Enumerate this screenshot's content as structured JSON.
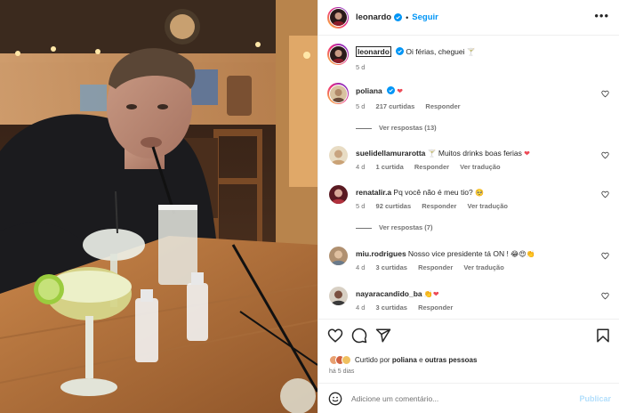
{
  "post": {
    "author": "leonardo",
    "follow_label": "Seguir",
    "caption": "Oi férias, cheguei",
    "caption_emoji": "🍸",
    "age": "5 d"
  },
  "comments": [
    {
      "user": "poliana",
      "verified": true,
      "text": "",
      "emoji": "❤",
      "age": "5 d",
      "likes": "217 curtidas",
      "reply": "Responder",
      "translate": "",
      "replies": "Ver respostas (13)"
    },
    {
      "user": "suelidellamurarotta",
      "text": "Muitos drinks boas ferias",
      "lead_emoji": "🍸",
      "emoji": "❤",
      "age": "4 d",
      "likes": "1 curtida",
      "reply": "Responder",
      "translate": "Ver tradução"
    },
    {
      "user": "renatalir.a",
      "text": "Pq você não é meu tio?",
      "emoji": "🥺",
      "age": "5 d",
      "likes": "92 curtidas",
      "reply": "Responder",
      "translate": "Ver tradução",
      "replies": "Ver respostas (7)"
    },
    {
      "user": "miu.rodrigues",
      "text": "Nosso vice presidente tá ON !",
      "emoji": "😂😍👏",
      "age": "4 d",
      "likes": "3 curtidas",
      "reply": "Responder",
      "translate": "Ver tradução"
    },
    {
      "user": "nayaracandido_ba",
      "text": "",
      "emoji": "👏❤",
      "age": "4 d",
      "likes": "3 curtidas",
      "reply": "Responder",
      "translate": ""
    }
  ],
  "likes_summary": {
    "prefix": "Curtido por",
    "user": "poliana",
    "joiner": "e",
    "others": "outras pessoas"
  },
  "post_date": "há 5 dias",
  "add_comment": {
    "placeholder": "Adicione um comentário...",
    "publish_label": "Publicar"
  },
  "icons": [
    "verified-icon",
    "more-icon",
    "heart-icon",
    "comment-icon",
    "share-icon",
    "bookmark-icon",
    "emoji-icon"
  ],
  "colors": {
    "link_blue": "#0095f6",
    "publish_disabled": "#b2dffc",
    "heart_red": "#ed4956",
    "muted": "#737373"
  }
}
